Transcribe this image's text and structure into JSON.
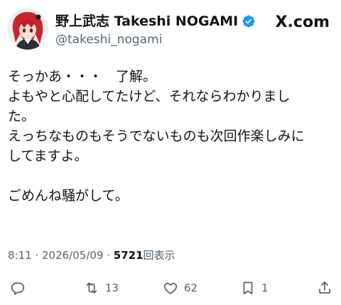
{
  "header": {
    "name": "野上武志 Takeshi NOGAMI",
    "handle": "@takeshi_nogami",
    "brand": "X.com",
    "verified_color": "#1d9bf0"
  },
  "post": {
    "lines": [
      "そっかあ・・・　了解。",
      "よもやと心配してたけど、それならわかりまし",
      "た。",
      "えっちなものもそうでないものも次回作楽しみに",
      "してますよ。",
      "",
      "ごめんね騒がして。"
    ]
  },
  "meta": {
    "time": "8:11",
    "separator": " · ",
    "date": "2026/05/09",
    "views_count": "5721",
    "views_label": "回表示"
  },
  "actions": {
    "reply_icon": "reply-icon",
    "repost_icon": "repost-icon",
    "repost_count": "13",
    "like_icon": "like-icon",
    "like_count": "62",
    "bookmark_icon": "bookmark-icon",
    "bookmark_count": "1",
    "share_icon": "share-icon"
  }
}
